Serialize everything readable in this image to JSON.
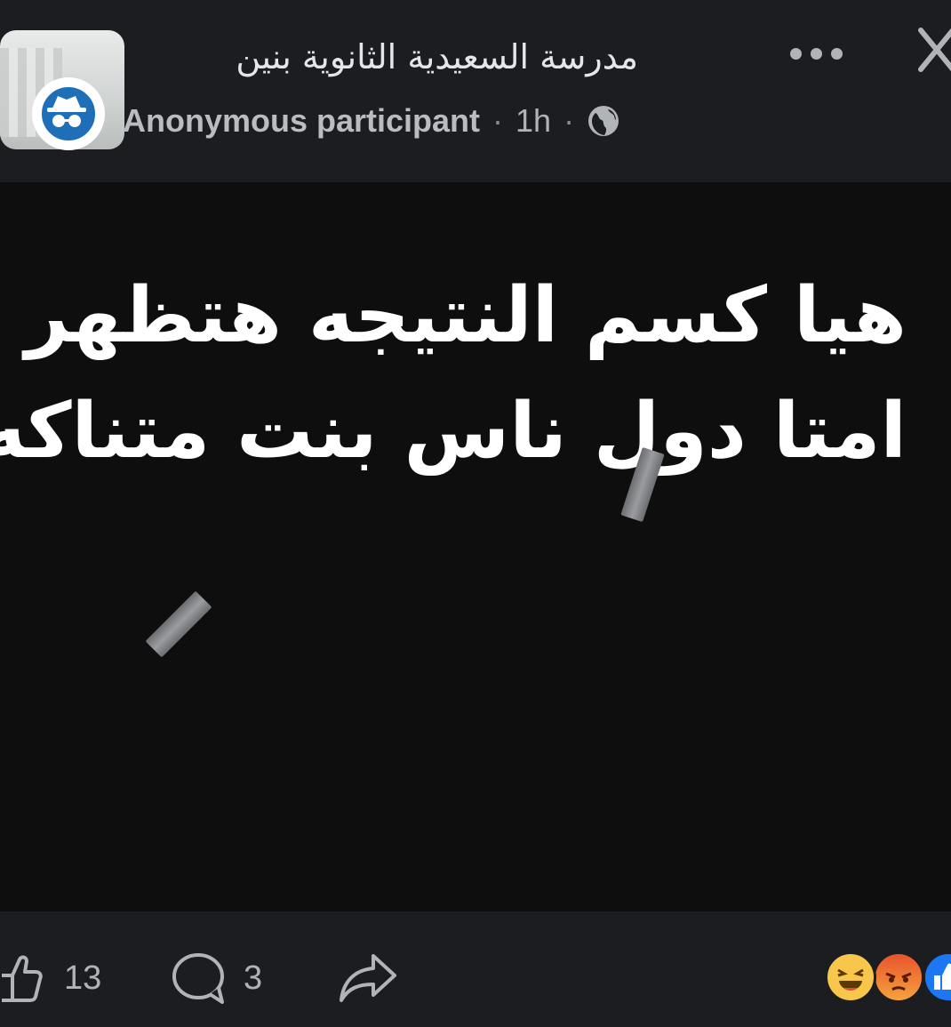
{
  "header": {
    "group_name": "مدرسة السعيدية الثانوية بنين",
    "author": "Anonymous participant",
    "separator": "·",
    "time": "1h",
    "privacy_icon": "globe-icon",
    "more_icon": "more-options-icon",
    "close_icon": "close-icon",
    "avatar_icon": "anonymous-incognito-icon"
  },
  "post": {
    "lines": [
      "هيا كسم النتيجه هتظهر",
      "امتا دول ناس بنت متناكه"
    ],
    "background_color": "#0e0e0f",
    "text_color": "#ffffff"
  },
  "actions": {
    "like_icon": "thumbs-up-icon",
    "like_count": "13",
    "comment_icon": "comment-bubble-icon",
    "comment_count": "3",
    "share_icon": "share-arrow-icon"
  },
  "reactions": [
    "haha-reaction-icon",
    "angry-reaction-icon",
    "like-reaction-icon"
  ],
  "colors": {
    "app_background": "#1b1d20",
    "primary_text": "#e4e6eb",
    "secondary_text": "#b0b3b8",
    "like_blue": "#1d77f2",
    "avatar_blue": "#1f6fb8"
  }
}
